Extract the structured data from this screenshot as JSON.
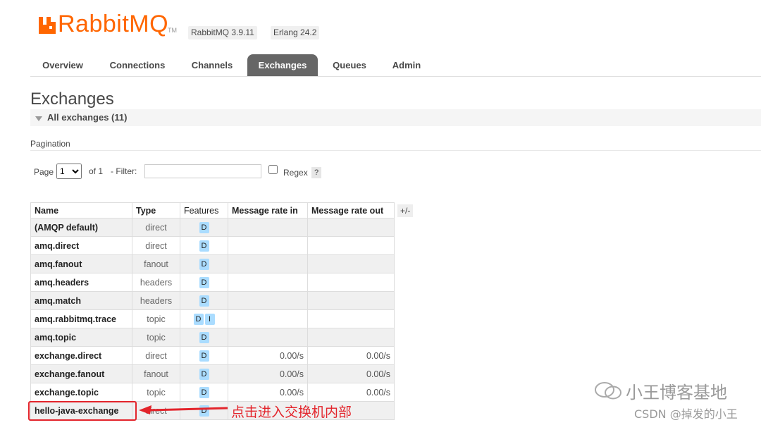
{
  "header": {
    "logo_text": "RabbitMQ",
    "logo_tm": "TM",
    "version_label": "RabbitMQ 3.9.11",
    "erlang_label": "Erlang 24.2",
    "brand_color": "#ff6600"
  },
  "nav": {
    "tabs": [
      {
        "label": "Overview"
      },
      {
        "label": "Connections"
      },
      {
        "label": "Channels"
      },
      {
        "label": "Exchanges",
        "active": true
      },
      {
        "label": "Queues"
      },
      {
        "label": "Admin"
      }
    ]
  },
  "page": {
    "title": "Exchanges",
    "section_title": "All exchanges (11)"
  },
  "pagination": {
    "label": "Pagination",
    "page_label": "Page",
    "page_value": "1",
    "of_label": "of 1",
    "filter_label": "- Filter:",
    "filter_value": "",
    "regex_label": "Regex",
    "help_label": "?"
  },
  "table": {
    "columns": [
      "Name",
      "Type",
      "Features",
      "Message rate in",
      "Message rate out"
    ],
    "column_toggle": "+/-",
    "rows": [
      {
        "name": "(AMQP default)",
        "type": "direct",
        "features": [
          "D"
        ],
        "rate_in": "",
        "rate_out": ""
      },
      {
        "name": "amq.direct",
        "type": "direct",
        "features": [
          "D"
        ],
        "rate_in": "",
        "rate_out": ""
      },
      {
        "name": "amq.fanout",
        "type": "fanout",
        "features": [
          "D"
        ],
        "rate_in": "",
        "rate_out": ""
      },
      {
        "name": "amq.headers",
        "type": "headers",
        "features": [
          "D"
        ],
        "rate_in": "",
        "rate_out": ""
      },
      {
        "name": "amq.match",
        "type": "headers",
        "features": [
          "D"
        ],
        "rate_in": "",
        "rate_out": ""
      },
      {
        "name": "amq.rabbitmq.trace",
        "type": "topic",
        "features": [
          "D",
          "I"
        ],
        "rate_in": "",
        "rate_out": ""
      },
      {
        "name": "amq.topic",
        "type": "topic",
        "features": [
          "D"
        ],
        "rate_in": "",
        "rate_out": ""
      },
      {
        "name": "exchange.direct",
        "type": "direct",
        "features": [
          "D"
        ],
        "rate_in": "0.00/s",
        "rate_out": "0.00/s"
      },
      {
        "name": "exchange.fanout",
        "type": "fanout",
        "features": [
          "D"
        ],
        "rate_in": "0.00/s",
        "rate_out": "0.00/s"
      },
      {
        "name": "exchange.topic",
        "type": "topic",
        "features": [
          "D"
        ],
        "rate_in": "0.00/s",
        "rate_out": "0.00/s"
      },
      {
        "name": "hello-java-exchange",
        "type": "direct",
        "features": [
          "D"
        ],
        "rate_in": "",
        "rate_out": ""
      }
    ]
  },
  "annotation": {
    "text": "点击进入交换机内部",
    "color": "#e3242b"
  },
  "watermark": {
    "line1": "小王博客基地",
    "line2": "CSDN @掉发的小王"
  }
}
